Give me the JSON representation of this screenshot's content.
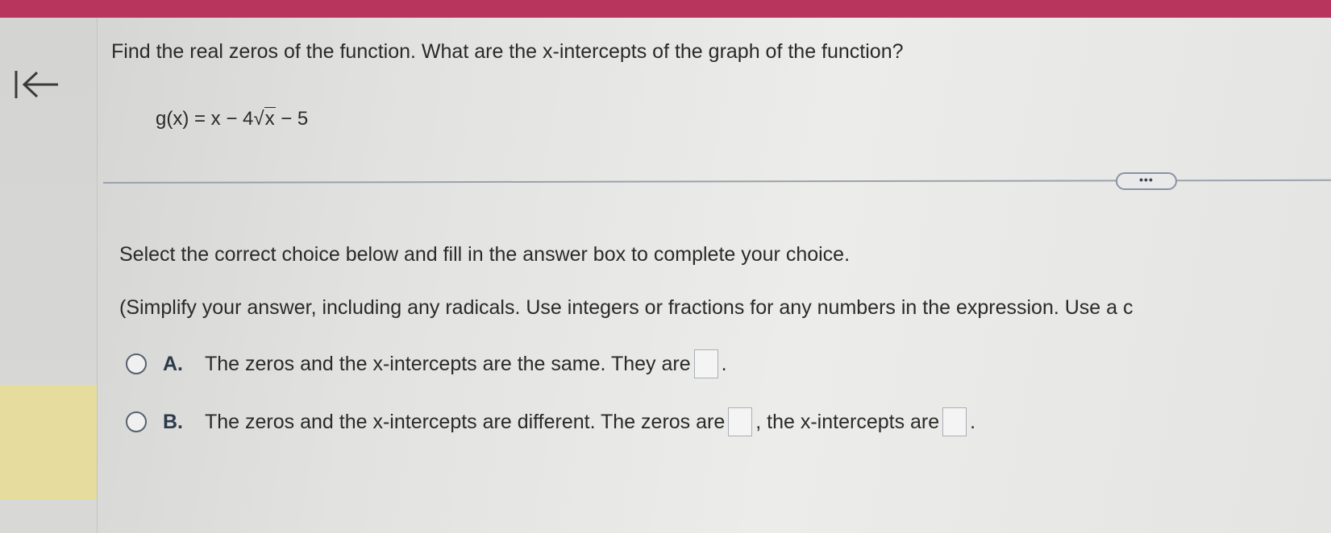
{
  "nav": {
    "back_icon": "first-page-arrow-icon"
  },
  "question": {
    "text": "Find the real zeros of the function. What are the x-intercepts of the graph of the function?",
    "formula_lhs": "g(x) = x − 4",
    "formula_radical": "√",
    "formula_radicand": "x",
    "formula_rhs": " − 5"
  },
  "more_button": {
    "label": "•••"
  },
  "instructions": {
    "main": "Select the correct choice below and fill in the answer box to complete your choice.",
    "hint": "(Simplify your answer, including any radicals. Use integers or fractions for any numbers in the expression. Use a c"
  },
  "choices": [
    {
      "letter": "A.",
      "text_before": "The zeros and the x-intercepts are the same. They are",
      "text_after": "."
    },
    {
      "letter": "B.",
      "text_before": "The zeros and the x-intercepts are different. The zeros are",
      "text_middle": ", the x-intercepts are",
      "text_after": "."
    }
  ],
  "colors": {
    "top_bar": "#b8365e",
    "rail_highlight": "#e6dc9e",
    "divider": "#9aa2ab"
  }
}
